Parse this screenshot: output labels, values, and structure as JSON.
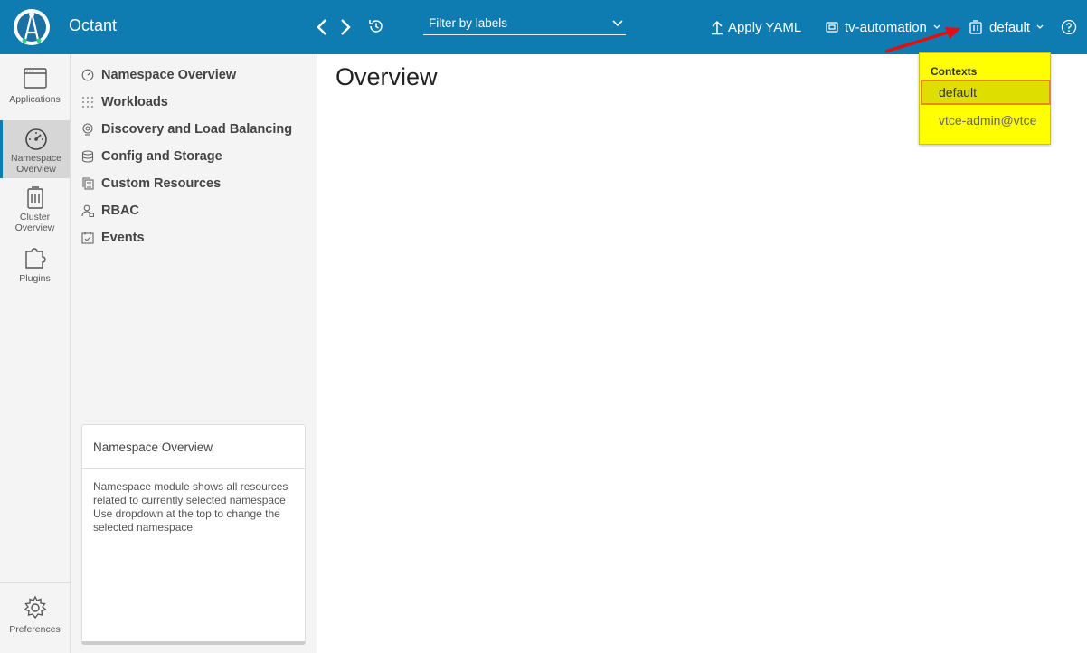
{
  "header": {
    "app_title": "Octant",
    "filter_placeholder": "Filter by labels",
    "apply_label": "Apply YAML",
    "namespace_label": "tv-automation",
    "context_label": "default",
    "bg_color": "#0e7bb1"
  },
  "rail": {
    "items": [
      {
        "label": "Applications",
        "icon": "applications-icon"
      },
      {
        "label": "Namespace Overview",
        "label_line1": "Namespace",
        "label_line2": "Overview",
        "icon": "dashboard-icon",
        "active": true
      },
      {
        "label": "Cluster Overview",
        "label_line1": "Cluster",
        "label_line2": "Overview",
        "icon": "cluster-icon"
      },
      {
        "label": "Plugins",
        "icon": "plugin-icon"
      }
    ],
    "preferences_label": "Preferences"
  },
  "subnav": {
    "items": [
      {
        "label": "Namespace Overview",
        "icon": "dashboard-icon"
      },
      {
        "label": "Workloads",
        "icon": "grid-icon"
      },
      {
        "label": "Discovery and Load Balancing",
        "icon": "network-icon"
      },
      {
        "label": "Config and Storage",
        "icon": "storage-icon"
      },
      {
        "label": "Custom Resources",
        "icon": "file-group-icon"
      },
      {
        "label": "RBAC",
        "icon": "user-lock-icon"
      },
      {
        "label": "Events",
        "icon": "calendar-check-icon"
      }
    ],
    "info_card": {
      "title": "Namespace Overview",
      "body": "Namespace module shows all resources related to currently selected namespace Use dropdown at the top to change the selected namespace"
    }
  },
  "main": {
    "title": "Overview"
  },
  "contexts_menu": {
    "heading": "Contexts",
    "items": [
      {
        "label": "default",
        "selected": true
      },
      {
        "label": "vtce-admin@vtce",
        "selected": false
      }
    ],
    "highlight_color": "#ffff00",
    "annotation_arrow_color": "#e01010"
  }
}
